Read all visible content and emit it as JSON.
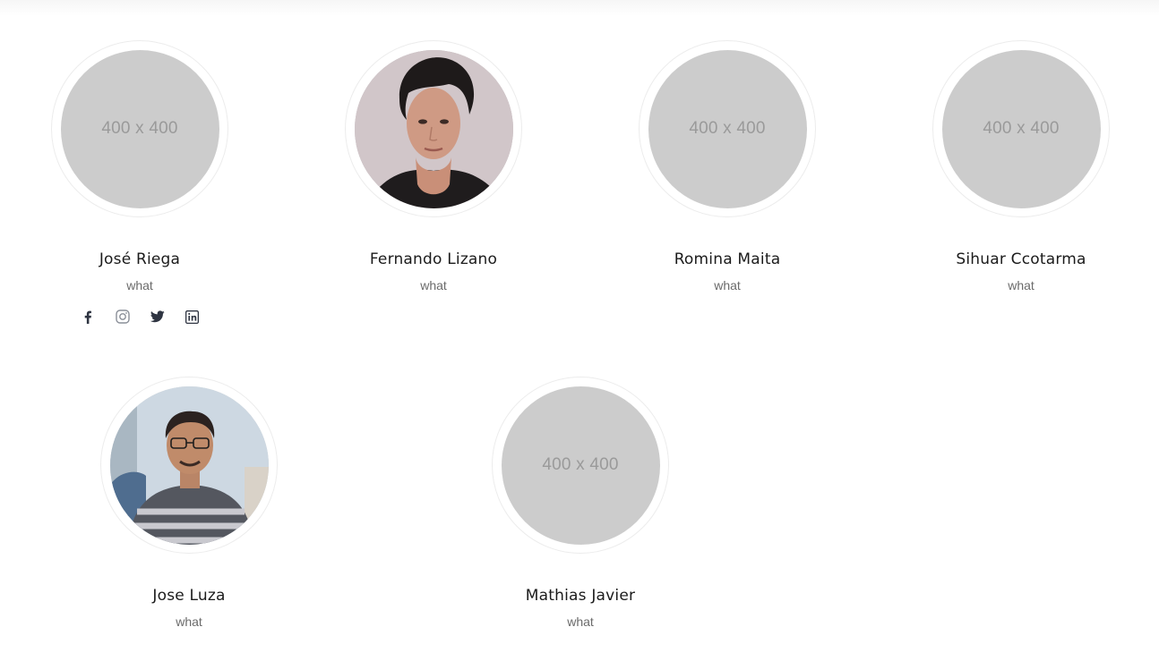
{
  "team": {
    "members": [
      {
        "name": "José Riega",
        "role": "what",
        "avatar": {
          "type": "placeholder",
          "placeholder_text": "400 x 400"
        },
        "socials": [
          "facebook-icon",
          "instagram-icon",
          "twitter-icon",
          "linkedin-icon"
        ]
      },
      {
        "name": "Fernando Lizano",
        "role": "what",
        "avatar": {
          "type": "photo"
        }
      },
      {
        "name": "Romina Maita",
        "role": "what",
        "avatar": {
          "type": "placeholder",
          "placeholder_text": "400 x 400"
        }
      },
      {
        "name": "Sihuar Ccotarma",
        "role": "what",
        "avatar": {
          "type": "placeholder",
          "placeholder_text": "400 x 400"
        }
      },
      {
        "name": "Jose Luza",
        "role": "what",
        "avatar": {
          "type": "photo"
        }
      },
      {
        "name": "Mathias Javier",
        "role": "what",
        "avatar": {
          "type": "placeholder",
          "placeholder_text": "400 x 400"
        }
      }
    ]
  },
  "colors": {
    "placeholder_bg": "#cccccc",
    "placeholder_text": "#9a9a9a",
    "social_icon": "#2f3542",
    "ring_border": "#ececec"
  }
}
